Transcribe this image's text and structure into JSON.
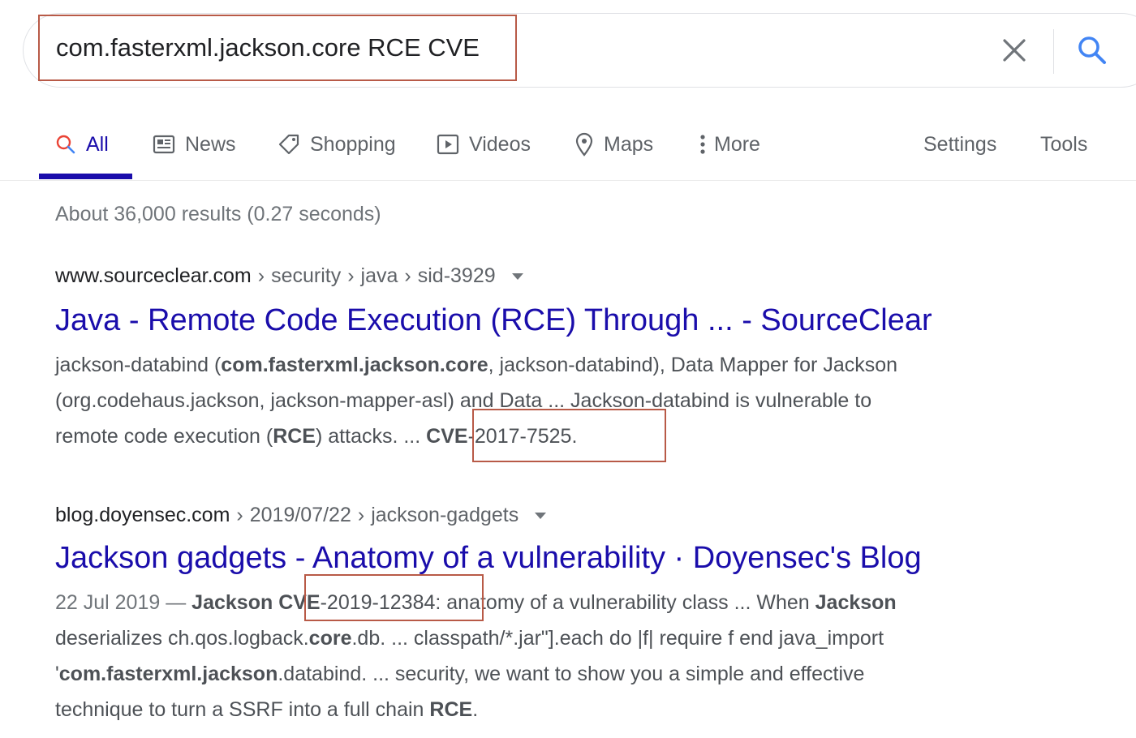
{
  "search": {
    "query": "com.fasterxml.jackson.core RCE CVE"
  },
  "tabs": [
    {
      "label": "All",
      "icon": "search-icon",
      "active": true
    },
    {
      "label": "News",
      "icon": "news-icon"
    },
    {
      "label": "Shopping",
      "icon": "tag-icon"
    },
    {
      "label": "Videos",
      "icon": "play-icon"
    },
    {
      "label": "Maps",
      "icon": "map-pin-icon"
    },
    {
      "label": "More",
      "icon": "more-vert-icon"
    }
  ],
  "tools": {
    "settings": "Settings",
    "tools": "Tools"
  },
  "stats": "About 36,000 results (0.27 seconds)",
  "results": [
    {
      "domain": "www.sourceclear.com",
      "sep": "›",
      "path": [
        "security",
        "java",
        "sid-3929"
      ],
      "title": "Java - Remote Code Execution (RCE) Through ... - SourceClear",
      "snippet": [
        [
          "jackson-databind (",
          "com.fasterxml.jackson.core",
          ", jackson-databind), Data Mapper for Jackson"
        ],
        [
          "(org.codehaus.jackson, jackson-mapper-asl) and Data ... Jackson-databind is vulnerable to"
        ],
        [
          "remote code execution (",
          "RCE",
          ") attacks. ... ",
          "CVE",
          "-2017-7525."
        ]
      ]
    },
    {
      "domain": "blog.doyensec.com",
      "sep": "›",
      "path": [
        "2019/07/22",
        "jackson-gadgets"
      ],
      "title": "Jackson gadgets - Anatomy of a vulnerability · Doyensec's Blog",
      "date": "22 Jul 2019 —",
      "snippet": [
        [
          " ",
          "Jackson",
          " ",
          "CVE",
          "-2019-12384: anatomy of a vulnerability class ... When ",
          "Jackson"
        ],
        [
          "deserializes ch.qos.logback.",
          "core",
          ".db. ... classpath/*.jar\"].each do |f| require f end java_import"
        ],
        [
          "'",
          "com.fasterxml.jackson",
          ".databind. ... security, we want to show you a simple and effective"
        ],
        [
          "technique to turn a SSRF into a full chain ",
          "RCE",
          "."
        ]
      ]
    }
  ]
}
